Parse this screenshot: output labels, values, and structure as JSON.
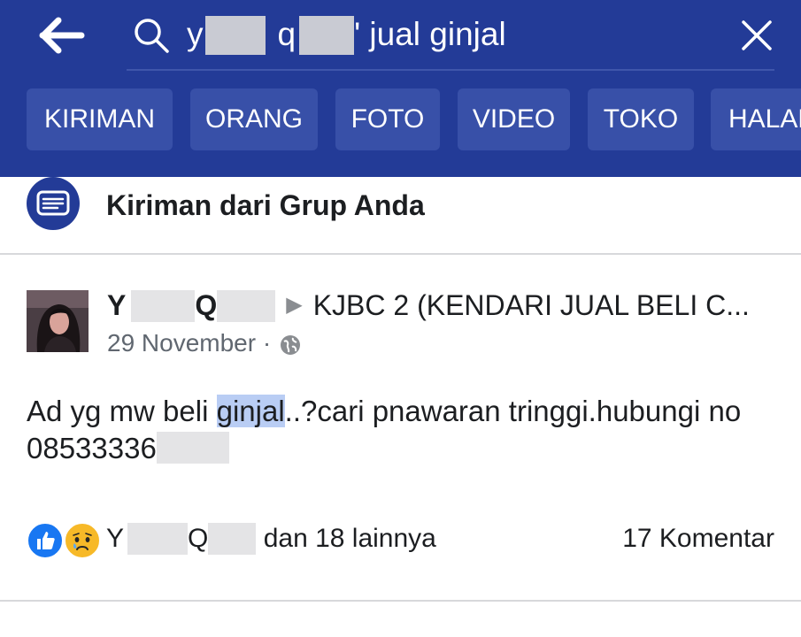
{
  "search": {
    "back_icon": "arrow-left-icon",
    "search_icon": "search-icon",
    "query_start": "y",
    "query_mid": "q",
    "query_end": "' jual ginjal",
    "close_icon": "close-icon"
  },
  "tabs": [
    {
      "label": "KIRIMAN"
    },
    {
      "label": "ORANG"
    },
    {
      "label": "FOTO"
    },
    {
      "label": "VIDEO"
    },
    {
      "label": "TOKO"
    },
    {
      "label": "HALAMAN"
    }
  ],
  "section": {
    "icon": "posts-icon",
    "title": "Kiriman dari Grup Anda"
  },
  "post": {
    "author_first": "Y",
    "author_last": "Q",
    "group": "KJBC 2 (KENDARI JUAL BELI C...",
    "date": "29 November",
    "separator": "·",
    "privacy_icon": "globe-icon",
    "text_before": "Ad yg mw beli ",
    "text_highlight": "ginjal",
    "text_after": "..?cari pnawaran tringgi.hubungi no 08533336",
    "reactor_first": "Y",
    "reactor_last": "Q",
    "reactions_suffix": "dan 18 lainnya",
    "comments": "17 Komentar",
    "colors": {
      "like": "#1877f2",
      "sad": "#f7b928",
      "highlight": "#b9cdf4",
      "header_bg": "#233b97"
    }
  }
}
